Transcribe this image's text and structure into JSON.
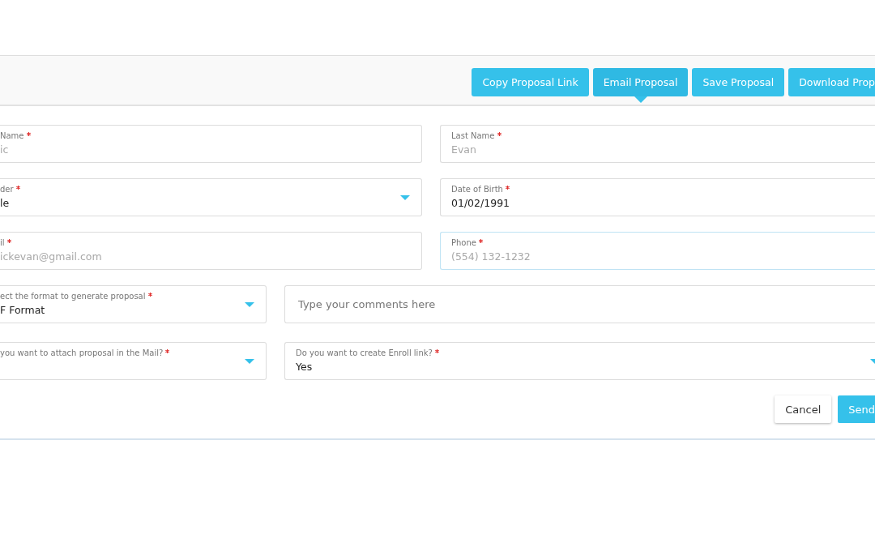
{
  "toolbar": {
    "buttons": [
      {
        "label": "Copy Proposal Link",
        "selected": false
      },
      {
        "label": "Email Proposal",
        "selected": true
      },
      {
        "label": "Save Proposal",
        "selected": false
      },
      {
        "label": "Download Prop",
        "selected": false
      }
    ]
  },
  "form": {
    "contact_rows": [
      {
        "fields": [
          {
            "kind": "text",
            "label": "Name",
            "required": true,
            "placeholder": "ic",
            "focused": false
          },
          {
            "kind": "text",
            "label": "Last Name",
            "required": true,
            "placeholder": "Evan",
            "focused": false
          }
        ]
      },
      {
        "fields": [
          {
            "kind": "select",
            "label": "der",
            "required": true,
            "value": "le",
            "focused": false
          },
          {
            "kind": "text",
            "label": "Date of Birth",
            "required": true,
            "value": "01/02/1991",
            "focused": false
          }
        ]
      },
      {
        "fields": [
          {
            "kind": "text",
            "label": "il",
            "required": true,
            "placeholder": "ickevan@gmail.com",
            "focused": false
          },
          {
            "kind": "text",
            "label": "Phone",
            "required": true,
            "placeholder": "(554) 132-1232",
            "focused": true
          }
        ]
      }
    ],
    "proposal_rows": [
      {
        "fields": [
          {
            "kind": "select",
            "label": "ect the format to generate proposal",
            "required": true,
            "value": "F Format",
            "focused": false
          },
          {
            "kind": "comment",
            "placeholder": "Type your comments here",
            "focused": false
          }
        ]
      },
      {
        "fields": [
          {
            "kind": "select",
            "label": "you want to attach proposal in the Mail?",
            "required": true,
            "focused": false
          },
          {
            "kind": "select",
            "label": "Do you want to create Enroll link?",
            "required": true,
            "value": "Yes",
            "focused": false
          }
        ]
      }
    ]
  },
  "actions": [
    {
      "kind": "secondary",
      "label": "Cancel"
    },
    {
      "kind": "primary",
      "label": "Send"
    }
  ]
}
